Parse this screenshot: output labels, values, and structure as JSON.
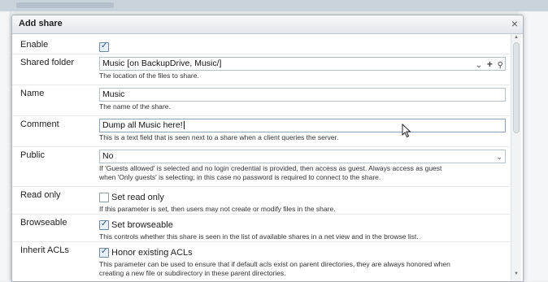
{
  "dialog": {
    "title": "Add share",
    "close_glyph": "×"
  },
  "fields": {
    "enable": {
      "label": "Enable",
      "checked": true
    },
    "shared_folder": {
      "label": "Shared folder",
      "value": "Music [on BackupDrive, Music/]",
      "note": "The location of the files to share.",
      "icons": [
        "chevron-down-icon",
        "plus-icon",
        "search-icon"
      ]
    },
    "name": {
      "label": "Name",
      "value": "Music",
      "note": "The name of the share."
    },
    "comment": {
      "label": "Comment",
      "value": "Dump all Music here!",
      "note": "This is a text field that is seen next to a share when a client queries the server."
    },
    "public": {
      "label": "Public",
      "value": "No",
      "note_line1": "If 'Guests allowed' is selected and no login credential is provided, then access as guest. Always access as guest",
      "note_line2": "when 'Only guests' is selecting; in this case no password is required to connect to the share."
    },
    "read_only": {
      "label": "Read only",
      "checkbox_label": "Set read only",
      "checked": false,
      "note": "If this parameter is set, then users may not create or modify files in the share."
    },
    "browseable": {
      "label": "Browseable",
      "checkbox_label": "Set browseable",
      "checked": true,
      "note": "This controls whether this share is seen in the list of available shares in a net view and in the browse list."
    },
    "inherit_acls": {
      "label": "Inherit ACLs",
      "checkbox_label": "Honor existing ACLs",
      "checked": true,
      "note_line1": "This parameter can be used to ensure that if default acls exist on parent directories, they are always honored when",
      "note_line2": "creating a new file or subdirectory in these parent directories."
    }
  },
  "glyphs": {
    "tick": "✓",
    "chevron": "⌄",
    "plus": "+",
    "search": "⚲"
  }
}
